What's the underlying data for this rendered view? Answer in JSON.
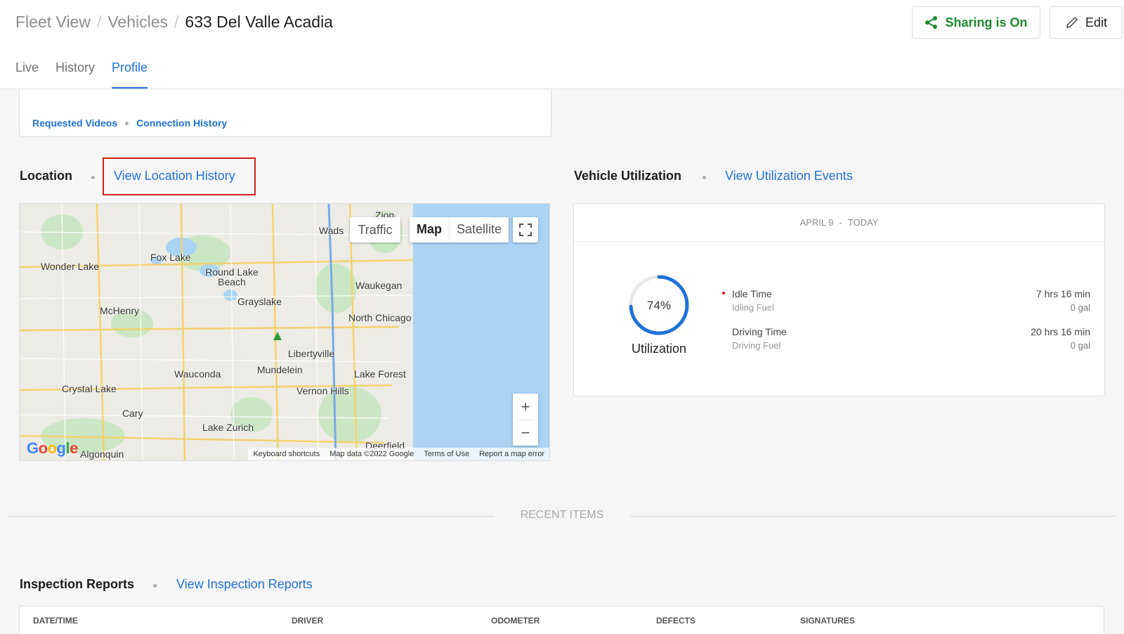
{
  "breadcrumb": {
    "item1": "Fleet View",
    "item2": "Vehicles",
    "current": "633 Del Valle Acadia",
    "separator": "/"
  },
  "actions": {
    "share_label": "Sharing is On",
    "edit_label": "Edit"
  },
  "tabs": [
    {
      "label": "Live"
    },
    {
      "label": "History"
    },
    {
      "label": "Profile",
      "active": true
    }
  ],
  "top_card": {
    "link1": "Requested Videos",
    "link2": "Connection History"
  },
  "location": {
    "title": "Location",
    "link": "View Location History"
  },
  "map": {
    "traffic_label": "Traffic",
    "map_label": "Map",
    "satellite_label": "Satellite",
    "zoom_in": "+",
    "zoom_out": "−",
    "places": [
      "Zion",
      "Wads",
      "Fox Lake",
      "Wonder Lake",
      "Round Lake Beach",
      "Waukegan",
      "Grayslake",
      "McHenry",
      "North Chicago",
      "Libertyville",
      "Wauconda",
      "Mundelein",
      "Lake Forest",
      "Crystal Lake",
      "Vernon Hills",
      "Cary",
      "Lake Zurich",
      "Algonquin",
      "Deerfield"
    ],
    "footer": [
      "Keyboard shortcuts",
      "Map data ©2022 Google",
      "Terms of Use",
      "Report a map error"
    ],
    "logo": "Google"
  },
  "utilization": {
    "title": "Vehicle Utilization",
    "link": "View Utilization Events",
    "range_start": "APRIL 9",
    "range_sep": "-",
    "range_end": "TODAY",
    "percent_text": "74%",
    "percent": 74,
    "gauge_label": "Utilization",
    "rows": [
      {
        "name": "Idle Time",
        "value": "7 hrs 16 min",
        "sub": "Idling Fuel",
        "subval": "0 gal"
      },
      {
        "name": "Driving Time",
        "value": "20 hrs 16 min",
        "sub": "Driving Fuel",
        "subval": "0 gal"
      }
    ],
    "accent": "#1e72d8"
  },
  "recent": {
    "label": "RECENT ITEMS"
  },
  "inspection": {
    "title": "Inspection Reports",
    "link": "View Inspection Reports",
    "columns": [
      "DATE/TIME",
      "DRIVER",
      "ODOMETER",
      "DEFECTS",
      "SIGNATURES"
    ]
  }
}
